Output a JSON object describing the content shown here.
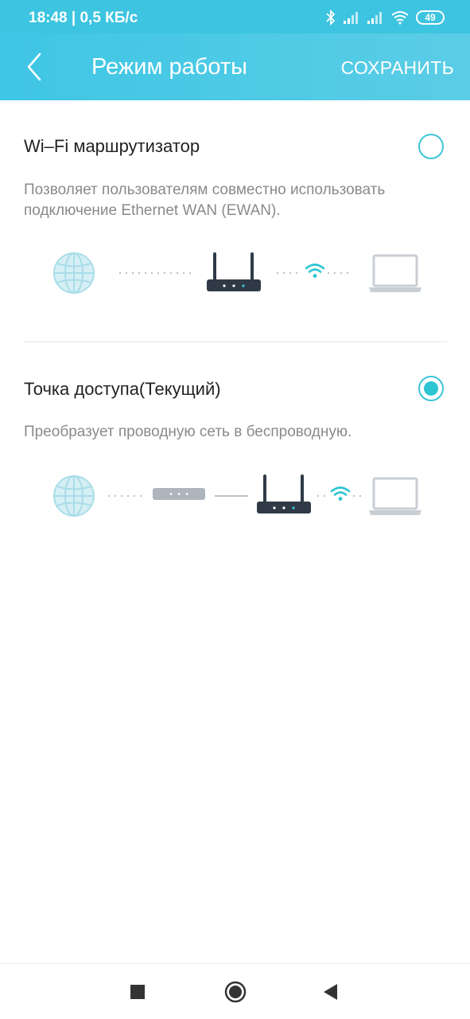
{
  "status_bar": {
    "time_speed": "18:48 | 0,5 КБ/с",
    "battery": "49"
  },
  "app_bar": {
    "title": "Режим работы",
    "save_label": "СОХРАНИТЬ",
    "back_icon": "chevron-left-icon"
  },
  "modes": [
    {
      "title": "Wi‒Fi маршрутизатор",
      "description": "Позволяет пользователям совместно использовать подключение Ethernet WAN (EWAN).",
      "selected": false
    },
    {
      "title": "Точка доступа(Текущий)",
      "description": "Преобразует проводную сеть в беспроводную.",
      "selected": true
    }
  ],
  "colors": {
    "accent": "#2ec5d3",
    "header": "#3ec6e4",
    "globe": "#a9dde8",
    "router": "#2f3a46",
    "laptop": "#c9ced3"
  },
  "nav_bar": {
    "icons": [
      "square-recents-icon",
      "circle-home-icon",
      "triangle-back-icon"
    ]
  }
}
